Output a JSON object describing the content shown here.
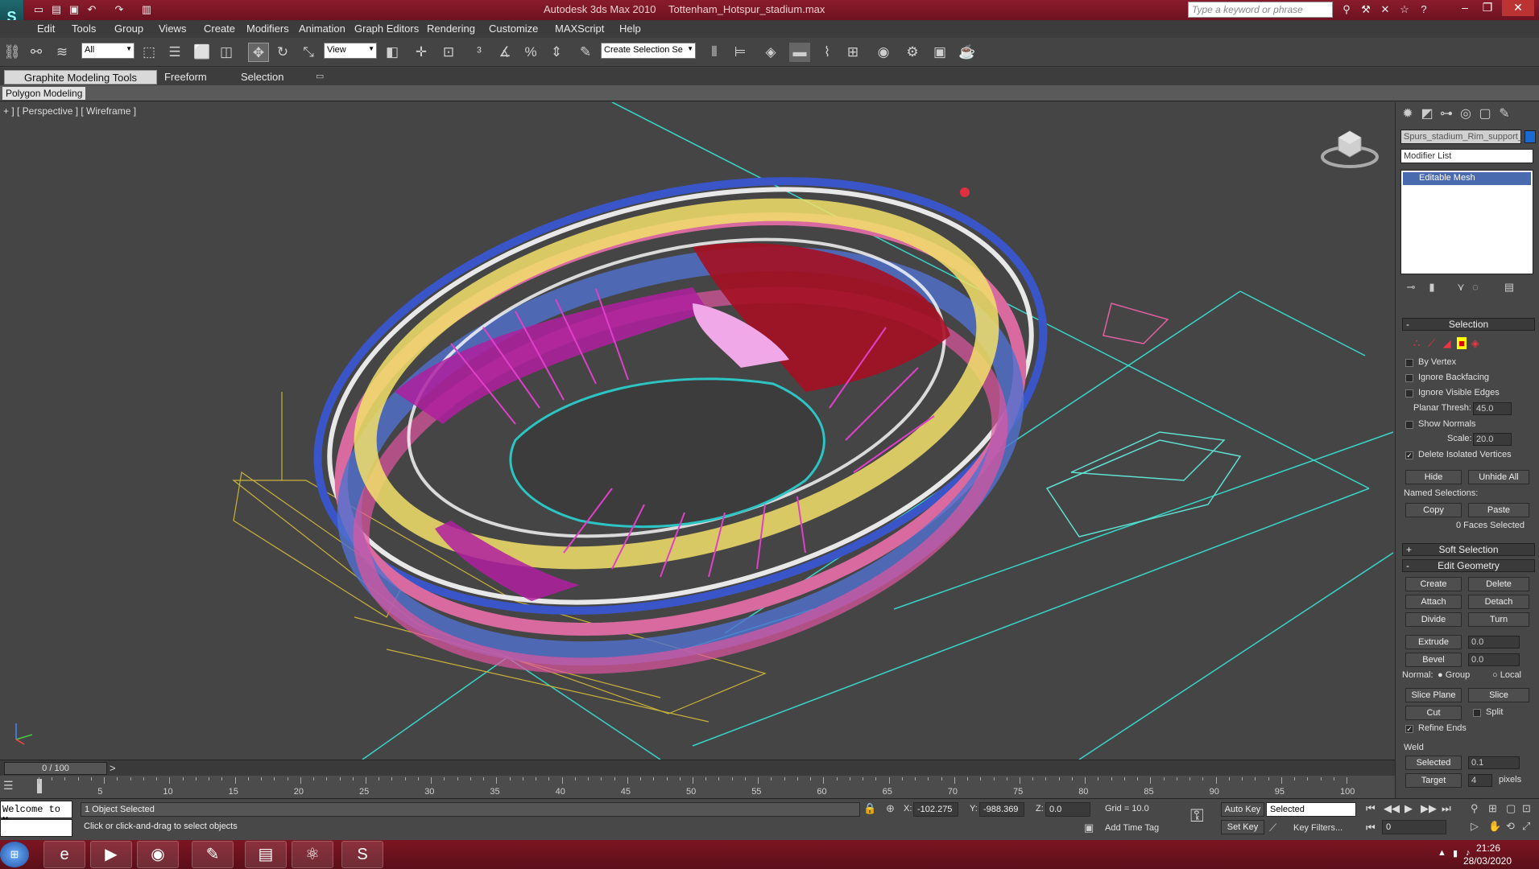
{
  "window": {
    "app_title": "Autodesk 3ds Max  2010",
    "file_name": "Tottenham_Hotspur_stadium.max",
    "search_placeholder": "Type a keyword or phrase",
    "logo_text": "S"
  },
  "menu": [
    "Edit",
    "Tools",
    "Group",
    "Views",
    "Create",
    "Modifiers",
    "Animation",
    "Graph Editors",
    "Rendering",
    "Customize",
    "MAXScript",
    "Help"
  ],
  "toolbar": {
    "selection_filter": "All",
    "ref_coord": "View",
    "named_selection": "Create Selection Se",
    "icons": [
      "link-icon",
      "unlink-icon",
      "bind-spacewarp-icon",
      "select-object-icon",
      "select-by-name-icon",
      "rect-region-icon",
      "window-crossing-icon",
      "select-move-icon",
      "select-rotate-icon",
      "select-scale-icon",
      "pivot-icon",
      "manipulate-icon",
      "snaps-icon",
      "angle-snap-icon",
      "percent-snap-icon",
      "spinner-snap-icon",
      "edit-named-sel-icon",
      "mirror-icon",
      "align-icon",
      "layer-manager-icon",
      "graphite-toggle-icon",
      "curve-editor-icon",
      "schematic-icon",
      "material-editor-icon",
      "render-setup-icon",
      "render-frame-icon",
      "quick-render-icon",
      "render-teapot-icon"
    ]
  },
  "ribbon": {
    "tabs": [
      "Graphite Modeling Tools",
      "Freeform",
      "Selection"
    ],
    "sub_tab": "Polygon Modeling"
  },
  "viewport": {
    "label": "+ ] [ Perspective ] [ Wireframe ]"
  },
  "command_panel": {
    "object_name": "Spurs_stadium_Rim_support_",
    "modifier_list": "Modifier List",
    "stack_item": "Editable Mesh",
    "selection_title": "Selection",
    "by_vertex": "By Vertex",
    "ignore_backfacing": "Ignore Backfacing",
    "ignore_visible_edges": "Ignore Visible Edges",
    "planar_thresh_label": "Planar Thresh:",
    "planar_thresh_value": "45.0",
    "show_normals": "Show Normals",
    "scale_label": "Scale:",
    "scale_value": "20.0",
    "delete_isolated": "Delete Isolated Vertices",
    "hide": "Hide",
    "unhide_all": "Unhide All",
    "named_selections": "Named Selections:",
    "copy": "Copy",
    "paste": "Paste",
    "faces_selected": "0 Faces Selected",
    "soft_selection": "Soft Selection",
    "edit_geometry": "Edit Geometry",
    "create": "Create",
    "delete": "Delete",
    "attach": "Attach",
    "detach": "Detach",
    "divide": "Divide",
    "turn": "Turn",
    "extrude": "Extrude",
    "extrude_value": "0.0",
    "bevel": "Bevel",
    "bevel_value": "0.0",
    "normal_label": "Normal:",
    "group": "Group",
    "local": "Local",
    "slice_plane": "Slice Plane",
    "slice": "Slice",
    "cut": "Cut",
    "split": "Split",
    "refine_ends": "Refine Ends",
    "weld": "Weld",
    "selected": "Selected",
    "selected_value": "0.1",
    "target": "Target",
    "target_value": "4",
    "pixels": "pixels"
  },
  "timeline": {
    "slider": "0 / 100",
    "ticks": [
      "5",
      "10",
      "15",
      "20",
      "25",
      "30",
      "35",
      "40",
      "45",
      "50",
      "55",
      "60",
      "65",
      "70",
      "75",
      "80",
      "85",
      "90",
      "95",
      "100"
    ]
  },
  "status": {
    "listener": "Welcome to M",
    "selected": "1 Object Selected",
    "prompt": "Click or click-and-drag to select objects",
    "x_label": "X:",
    "x_value": "-102.275",
    "y_label": "Y:",
    "y_value": "-988.369",
    "z_label": "Z:",
    "z_value": "0.0",
    "grid": "Grid = 10.0",
    "add_time_tag": "Add Time Tag",
    "auto_key": "Auto Key",
    "set_key": "Set Key",
    "key_mode": "Selected",
    "key_filters": "Key Filters...",
    "frame": "0"
  },
  "taskbar": {
    "time": "21:26",
    "date": "28/03/2020",
    "apps": [
      "start-orb-icon",
      "ie-icon",
      "media-player-icon",
      "chrome-icon",
      "paint-icon",
      "explorer-icon",
      "app-icon",
      "3dsmax-icon"
    ]
  }
}
